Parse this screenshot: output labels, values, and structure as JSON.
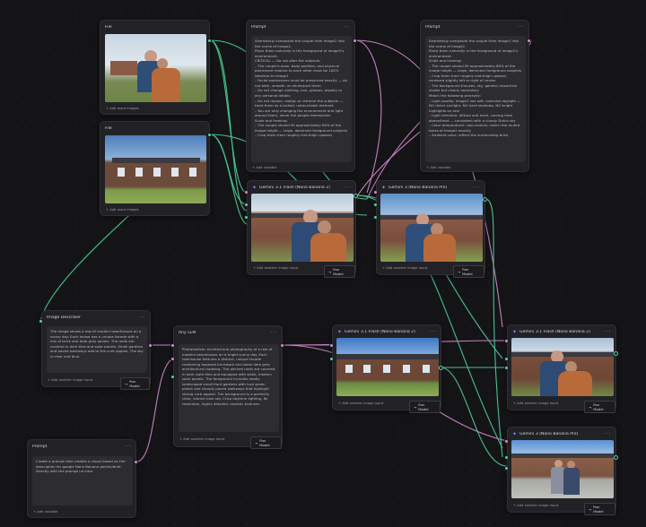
{
  "nodes": {
    "file1": {
      "title": "File",
      "footer": "+ Add more images"
    },
    "file2": {
      "title": "File",
      "footer": "+ Add more images"
    },
    "prompt1": {
      "title": "Prompt",
      "text": "Seamlessly composite the couple from image1 into the scene of image2.\nPlace them naturally in the foreground of image2's environment.\nCRITICAL — Do not alter the subjects:\n– The couple's pose, body position, and physical placement relative to each other must be 100% identical to image1\n– Facial expressions must be preserved exactly — do not alter, smooth, or reinterpret them\n– Do not change clothing, hair, glasses, jewelry or any personal details\n– Do not repose, realign or reframe the subjects — treat them as a locked, untouchable element\n– You are only changing the environment and light around them, never the people themselves\nScale and framing:\n– The couple should fill approximately 80% of the image height — large, dominant foreground subjects\n– Crop them from roughly mid-thigh upward,",
      "footer": "+ Add variable"
    },
    "prompt2": {
      "title": "Prompt",
      "text": "Seamlessly composite the couple from image1 into the scene of image2.\nPlace them naturally in the foreground of image2's environment.\nScale and framing:\n– The couple should fill approximately 80% of the image height — large, dominant foreground subjects\n– Crop them from roughly mid-thigh upward, centered slightly left or right of center\n– The background (houses, sky, garden) should be visible but clearly secondary\nMatch the following precisely:\n– Light quality: image2 has soft, overcast daylight — NO direct sunlight, NO hard shadows, NO bright highlights on skin\n– Light direction: diffuse and even, coming from above/front — consistent with a cloudy Dutch sky\n– Color temperature: cool-neutral, match the muted tones of image2 exactly\n– Ambient color: reflect the surrounding brick,",
      "footer": "+ Add variable"
    },
    "gen1": {
      "title": "Gemini 3.1 Flash (Nano Banana 2)",
      "footer": "+ Add another image input",
      "run": "Run Model"
    },
    "gen2": {
      "title": "Gemini 3 (Nano Banana Pro)",
      "footer": "+ Add another image input",
      "run": "Run Model"
    },
    "describer": {
      "title": "Image Describer",
      "text": "The image shows a row of modern townhouses on a sunny day. Each house has a unique facade with a mix of brick and dark grey panels. The roofs are covered in dark tiles and solar panels. Small gardens and paved walkways add to the curb appeal. The sky is clear and blue.",
      "footer": "+ Add another image input",
      "run": "Run Model"
    },
    "llm": {
      "title": "Any LLM",
      "text": "Photorealistic architectural photography of a row of modern townhouses on a bright sunny day. Each townhouse features a distinct, unique facade combining exposed brickwork and sleek dark grey architectural cladding. The pitched roofs are covered in dark slate tiles and equipped with sleek, modern solar panels. The foreground includes neatly landscaped small front gardens with lush green plants and sharply paved walkways that highlight strong curb appeal. The background is a perfectly clear, vibrant blue sky. Crisp daytime lighting, 8k resolution, highly detailed, realistic textures.",
      "footer": "+ Add another image input",
      "run": "Run Model"
    },
    "prompt3": {
      "title": "Prompt",
      "text": "Create a prompt that creates a visual based on the description for google Nano Banana gemini/bnet directly with the prompt no intro.",
      "footer": "+ Add variable"
    },
    "gen3": {
      "title": "Gemini 3.1 Flash (Nano Banana 2)",
      "footer": "+ Add another image input",
      "run": "Run Model"
    },
    "gen4": {
      "title": "Gemini 3.1 Flash (Nano Banana 2)",
      "footer": "+ Add another image input",
      "run": "Run Model"
    },
    "gen5": {
      "title": "Gemini 3 (Nano Banana Pro)",
      "footer": "+ Add another image input",
      "run": "Run Model"
    }
  },
  "icons": {
    "more": "more-icon",
    "spark": "spark-icon",
    "arrow": "arrow-right-icon"
  },
  "colors": {
    "wire_green": "#4fd39b",
    "wire_pink": "#d68ad0",
    "accent": "#8a7dff"
  }
}
